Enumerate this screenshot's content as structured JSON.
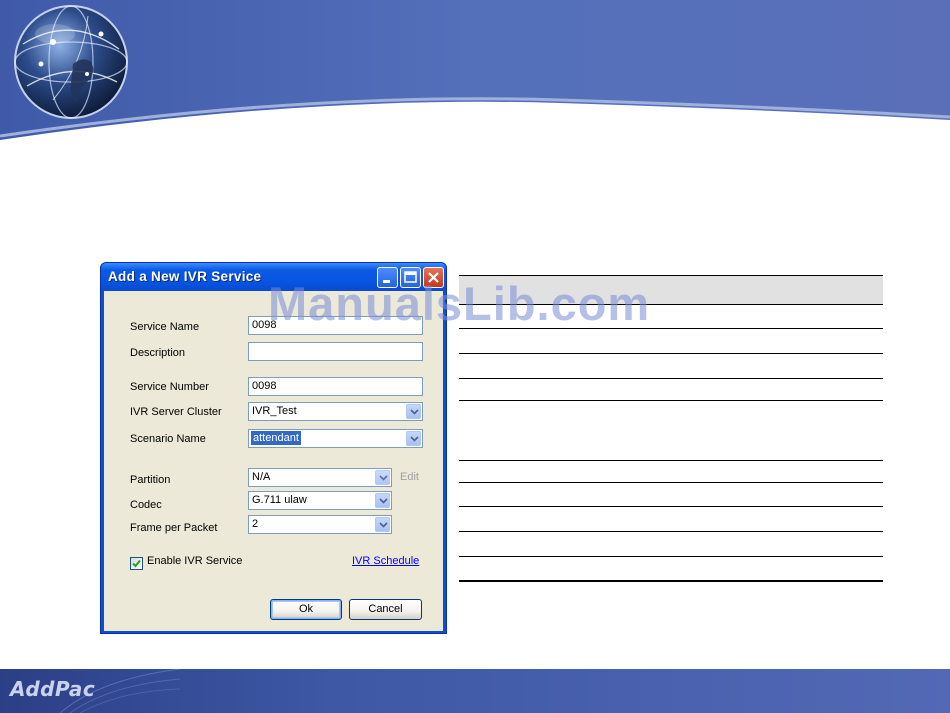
{
  "slide": {
    "footer_logo": "AddPac",
    "watermark": "ManualsLib.com",
    "colors": {
      "header_blue": "#5068b4",
      "footer_blue": "#3e58a6"
    }
  },
  "dialog": {
    "title": "Add a New IVR Service",
    "fields": {
      "service_name": {
        "label": "Service Name",
        "value": "0098"
      },
      "description": {
        "label": "Description",
        "value": ""
      },
      "service_number": {
        "label": "Service Number",
        "value": "0098"
      },
      "ivr_server_cluster": {
        "label": "IVR Server Cluster",
        "value": "IVR_Test"
      },
      "scenario_name": {
        "label": "Scenario Name",
        "value": "attendant"
      },
      "partition": {
        "label": "Partition",
        "value": "N/A",
        "edit_label": "Edit"
      },
      "codec": {
        "label": "Codec",
        "value": "G.711 ulaw"
      },
      "frame_per_packet": {
        "label": "Frame per Packet",
        "value": "2"
      }
    },
    "enable_ivr_service": {
      "label": "Enable IVR Service",
      "checked": true
    },
    "ivr_schedule_link": "IVR Schedule",
    "ok_label": "Ok",
    "cancel_label": "Cancel",
    "icons": [
      "minimize-icon",
      "maximize-icon",
      "close-icon",
      "chevron-down-icon",
      "checkmark-icon"
    ]
  }
}
